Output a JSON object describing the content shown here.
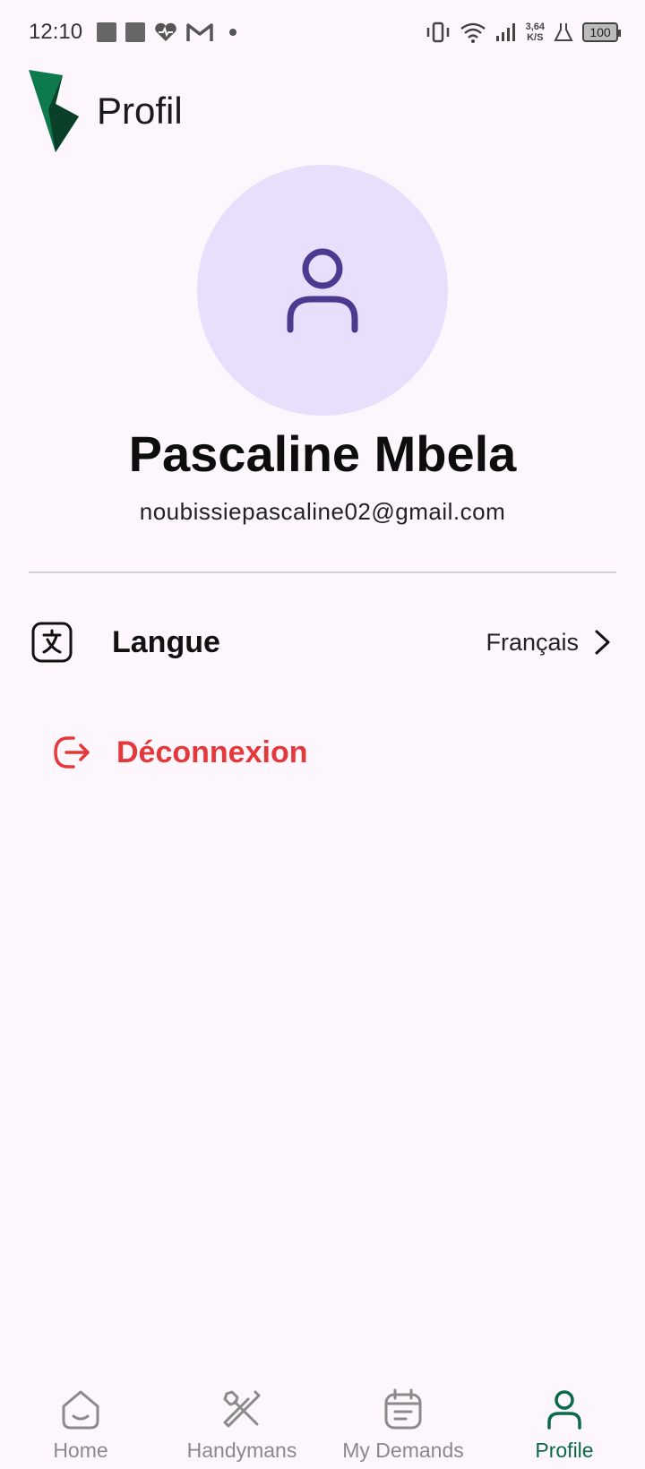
{
  "status_bar": {
    "time": "12:10",
    "net_speed_value": "3,64",
    "net_speed_unit": "K/S",
    "battery": "100"
  },
  "header": {
    "title": "Profil"
  },
  "profile": {
    "name": "Pascaline Mbela",
    "email": "noubissiepascaline02@gmail.com"
  },
  "settings": {
    "language_label": "Langue",
    "language_value": "Français",
    "logout_label": "Déconnexion"
  },
  "bottom_nav": {
    "items": [
      {
        "label": "Home",
        "icon": "home-icon"
      },
      {
        "label": "Handymans",
        "icon": "tools-icon"
      },
      {
        "label": "My Demands",
        "icon": "calendar-icon"
      },
      {
        "label": "Profile",
        "icon": "person-icon",
        "active": true
      }
    ]
  },
  "colors": {
    "accent": "#0a6a48",
    "avatar_bg": "#e9defb",
    "avatar_icon": "#4b3a8f",
    "danger": "#e5383b",
    "background": "#fdf7fd"
  }
}
